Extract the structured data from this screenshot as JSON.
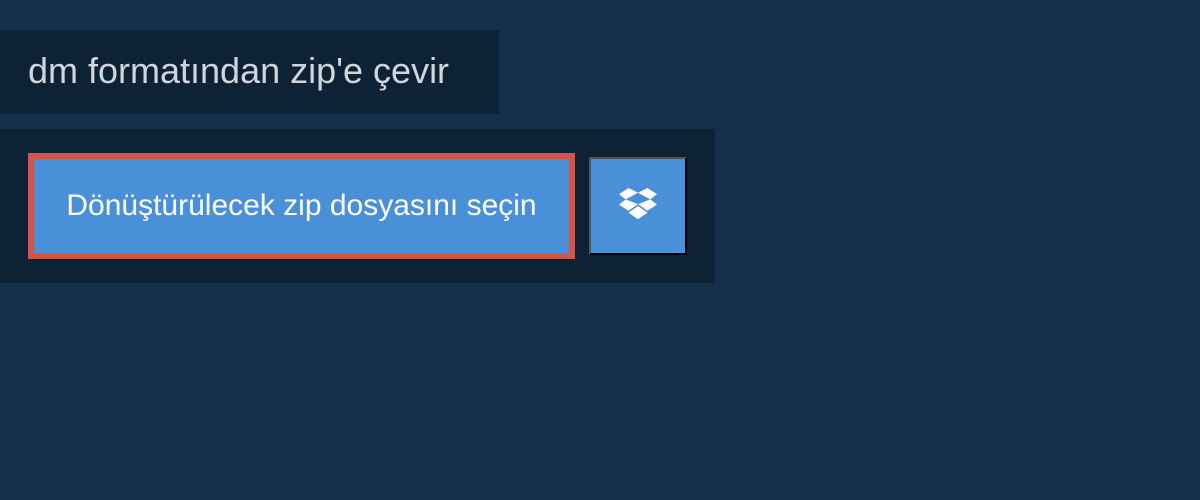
{
  "header": {
    "title": "dm formatından zip'e çevir"
  },
  "main": {
    "file_select_label": "Dönüştürülecek zip dosyasını seçin",
    "dropbox_icon_name": "dropbox-icon"
  }
}
